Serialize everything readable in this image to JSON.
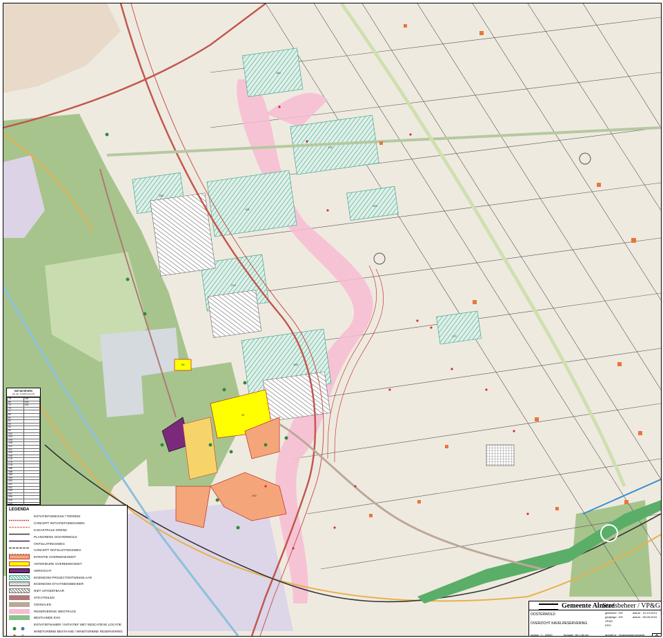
{
  "legend": {
    "title": "LEGENDA",
    "items": [
      {
        "label": "INITIATIEFGEBOUW / TERREIN",
        "kind": "line",
        "color": "#c0392b",
        "dash": "2,1"
      },
      {
        "label": "CONCEPT INITIATIEFGEBOUWEN",
        "kind": "line",
        "color": "#e57373",
        "dash": "3,1"
      },
      {
        "label": "KADASTRALE GRENS",
        "kind": "line",
        "color": "#333333",
        "dash": "none"
      },
      {
        "label": "PLANGRENS OOSTERWOLD",
        "kind": "line",
        "color": "#4a2060",
        "dash": "none"
      },
      {
        "label": "ONTSLUITINGSWEG",
        "kind": "line",
        "color": "#555555",
        "dash": "4,1"
      },
      {
        "label": "CONCEPT ONTSLUITINGSWEG",
        "kind": "line",
        "color": "#999999",
        "dash": "2,2"
      },
      {
        "label": "INTENTIE OVEREENKOMST",
        "kind": "fill",
        "color": "#f4a67a",
        "border": "#c0392b"
      },
      {
        "label": "ANTERIEURE OVEREENKOMST",
        "kind": "fill",
        "color": "#ffff00",
        "border": "#c0392b"
      },
      {
        "label": "VERKOCHT",
        "kind": "fill",
        "color": "#7b2a7b",
        "border": "#000000"
      },
      {
        "label": "EIGENDOM PROJECTONTWIKKELAAR",
        "kind": "hatch",
        "color": "#46a890"
      },
      {
        "label": "EIGENDOM STAATSBOSBEHEER",
        "kind": "grid",
        "color": "#666666"
      },
      {
        "label": "NIET UITGEEFBAAR",
        "kind": "hatch",
        "color": "#777777"
      },
      {
        "label": "STICHTEILEN",
        "kind": "fill",
        "color": "#b07878",
        "border": "#b07878"
      },
      {
        "label": "CENNALEN",
        "kind": "fill",
        "color": "#bba898",
        "border": "#bba898"
      },
      {
        "label": "RESERVERING WEGTRACE",
        "kind": "fill",
        "color": "#f7bcd2",
        "border": "#f7bcd2"
      },
      {
        "label": "BESTAANDE EHS",
        "kind": "fill",
        "color": "#86c08a",
        "border": "#86c08a"
      },
      {
        "label": "INITIATIEFNAMER / INITIATIEF MET INDICATIEVE LOCATIE",
        "kind": "dots",
        "color": "#2e8b3a"
      },
      {
        "label": "WINDTURBINE BESTAAND / WINDTURBINE RESERVERING",
        "kind": "dots2",
        "color": "#e05a2a"
      }
    ]
  },
  "initiatives": {
    "title": "INITIATIEVEN",
    "subtitle": "(op par. contactmoment)",
    "rows": [
      [
        "78",
        "216"
      ],
      [
        "60",
        "218"
      ],
      [
        "73",
        "219"
      ],
      [
        "75",
        ""
      ],
      [
        "77",
        ""
      ],
      [
        "80",
        ""
      ],
      [
        "81",
        ""
      ],
      [
        "82",
        ""
      ],
      [
        "90",
        ""
      ],
      [
        "91",
        ""
      ],
      [
        "92",
        ""
      ],
      [
        "102",
        ""
      ],
      [
        "103",
        ""
      ],
      [
        "105",
        ""
      ],
      [
        "108",
        ""
      ],
      [
        "110",
        ""
      ],
      [
        "112",
        ""
      ],
      [
        "118",
        ""
      ],
      [
        "126",
        ""
      ],
      [
        "175",
        ""
      ],
      [
        "176",
        ""
      ],
      [
        "178",
        ""
      ],
      [
        "186",
        ""
      ],
      [
        "188",
        ""
      ],
      [
        "189",
        ""
      ],
      [
        "190",
        ""
      ],
      [
        "200",
        ""
      ],
      [
        "201",
        ""
      ],
      [
        "202",
        ""
      ],
      [
        "205",
        ""
      ],
      [
        "207",
        ""
      ],
      [
        "208",
        ""
      ],
      [
        "209",
        ""
      ],
      [
        "210",
        ""
      ]
    ]
  },
  "title_block": {
    "organization": "Gemeente Almere",
    "department": "Stadsbeheer / VP&G",
    "project": "OOSTERWOLD",
    "subject": "OVERZICHT KAVELRESERVERING",
    "scale": "schaal : 1 : 15000",
    "format": "formaat : 60 x 84 cm",
    "drawn": "getekend : DH",
    "checked": "gewijzigd : DH",
    "date1": "datum : 15-10-2014",
    "date2": "datum : 06-08-2016",
    "status": "VP&G",
    "dso": "DSO",
    "archive": "archief nr : Oosterwold/overzicht"
  },
  "map_labels": {
    "plot_30": "30",
    "plot_58": "58",
    "plot_172": "172",
    "plot_160": "160",
    "plot_178": "178",
    "plot_118": "118",
    "plot_185": "185",
    "plot_210": "210",
    "plot_109": "109",
    "plot_198": "198",
    "plot_200": "200"
  },
  "colors": {
    "background": "#efeae0",
    "green_area": "#9bba82",
    "light_green": "#c2d8a8",
    "pink_corridor": "#f7bcd2",
    "teal_hatch": "#46a890",
    "yellow": "#ffff00",
    "salmon": "#f4a67a",
    "purple": "#7b2a7b",
    "road_orange": "#e8b04a",
    "water": "#8cc0dc"
  }
}
